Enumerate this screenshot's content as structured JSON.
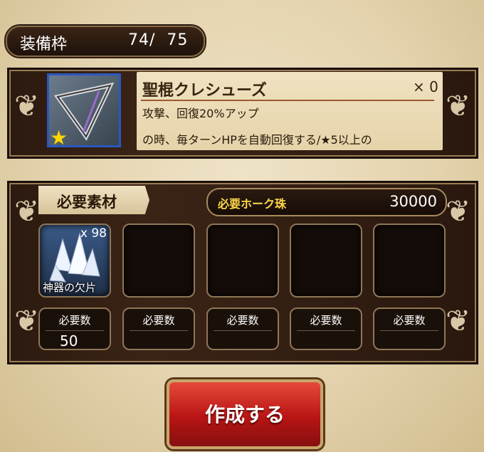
{
  "capacity": {
    "label": "装備枠",
    "count": "74/  75"
  },
  "item": {
    "name": "聖棍クレシューズ",
    "quantity": "× 0",
    "desc_line1": "攻撃、回復20%アップ",
    "desc_line2": "の時、毎ターンHPを自動回復する/★5以上の",
    "rarity_icon": "star-icon"
  },
  "materials": {
    "title": "必要素材",
    "currency_label": "必要ホーク珠",
    "currency_value": "30000",
    "slots": [
      {
        "name": "神器の欠片",
        "count": "x 98",
        "required_label": "必要数",
        "required_value": "50"
      },
      {
        "name": "",
        "count": "",
        "required_label": "必要数",
        "required_value": ""
      },
      {
        "name": "",
        "count": "",
        "required_label": "必要数",
        "required_value": ""
      },
      {
        "name": "",
        "count": "",
        "required_label": "必要数",
        "required_value": ""
      },
      {
        "name": "",
        "count": "",
        "required_label": "必要数",
        "required_value": ""
      }
    ]
  },
  "create_button": "作成する",
  "colors": {
    "accent": "#c81818",
    "gold": "#ffd74a",
    "wood": "#3b2416"
  }
}
